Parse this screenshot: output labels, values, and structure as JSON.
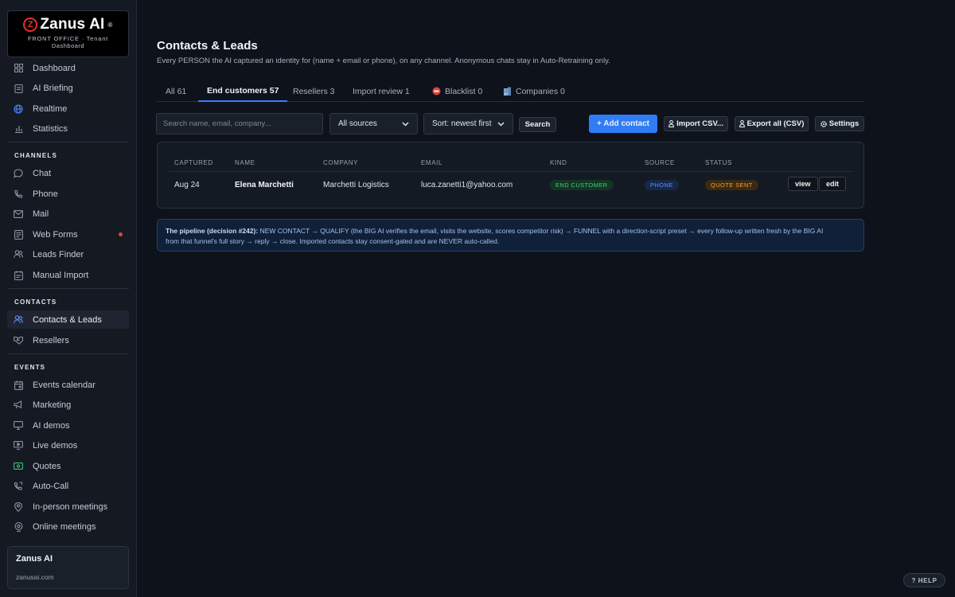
{
  "brand": {
    "name": "Zanus AI",
    "mark": "Z",
    "registered": "®",
    "line1": "FRONT OFFICE · Tenant",
    "line2": "Dashboard"
  },
  "nav": {
    "top": [
      {
        "label": "Dashboard",
        "icon": "grid-icon"
      },
      {
        "label": "AI Briefing",
        "icon": "clipboard-icon"
      },
      {
        "label": "Realtime",
        "icon": "globe-icon"
      },
      {
        "label": "Statistics",
        "icon": "bar-chart-icon"
      }
    ],
    "channels_title": "CHANNELS",
    "channels": [
      {
        "label": "Chat",
        "icon": "chat-icon"
      },
      {
        "label": "Phone",
        "icon": "phone-icon"
      },
      {
        "label": "Mail",
        "icon": "mail-icon"
      },
      {
        "label": "Web Forms",
        "icon": "form-icon",
        "dot": true
      },
      {
        "label": "Leads Finder",
        "icon": "people-icon"
      },
      {
        "label": "Manual Import",
        "icon": "import-icon"
      }
    ],
    "contacts_title": "CONTACTS",
    "contacts": [
      {
        "label": "Contacts & Leads",
        "icon": "users-icon",
        "active": true
      },
      {
        "label": "Resellers",
        "icon": "handshake-icon"
      }
    ],
    "events_title": "EVENTS",
    "events": [
      {
        "label": "Events calendar",
        "icon": "calendar-icon"
      },
      {
        "label": "Marketing",
        "icon": "megaphone-icon"
      },
      {
        "label": "AI demos",
        "icon": "monitor-icon"
      },
      {
        "label": "Live demos",
        "icon": "play-icon"
      },
      {
        "label": "Quotes",
        "icon": "money-icon"
      },
      {
        "label": "Auto-Call",
        "icon": "phone-auto-icon"
      },
      {
        "label": "In-person meetings",
        "icon": "pin-icon"
      },
      {
        "label": "Online meetings",
        "icon": "video-pin-icon"
      }
    ]
  },
  "tenant": {
    "name": "Zanus AI",
    "url": "zanusai.com"
  },
  "page": {
    "title": "Contacts & Leads",
    "subtitle": "Every PERSON the AI captured an identity for (name + email or phone), on any channel. Anonymous chats stay in Auto-Retraining only."
  },
  "tabs": [
    {
      "label": "All 61"
    },
    {
      "label": "End customers 57",
      "active": true
    },
    {
      "label": "Resellers 3"
    },
    {
      "label": "Import review 1"
    },
    {
      "label": "Blacklist 0",
      "icon": "no-entry-icon"
    },
    {
      "label": "Companies 0",
      "icon": "building-icon"
    }
  ],
  "toolbar": {
    "search_placeholder": "Search name, email, company...",
    "source_select": "All sources",
    "sort_select": "Sort: newest first",
    "search_btn": "Search",
    "add_btn": "+ Add contact",
    "import_btn": "Import CSV...",
    "export_btn": "Export all (CSV)",
    "settings_btn": "Settings"
  },
  "table": {
    "columns": [
      "CAPTURED",
      "NAME",
      "COMPANY",
      "EMAIL",
      "KIND",
      "SOURCE",
      "STATUS"
    ],
    "rows": [
      {
        "captured": "Aug 24",
        "name": "Elena Marchetti",
        "company": "Marchetti Logistics",
        "email": "luca.zanetti1@yahoo.com",
        "kind": "END CUSTOMER",
        "source": "PHONE",
        "status": "QUOTE SENT",
        "view": "view",
        "edit": "edit"
      }
    ]
  },
  "info": {
    "title": "The pipeline (decision #242):",
    "line1": " NEW CONTACT → QUALIFY (the BIG AI verifies the email, visits the website, scores competitor risk) → FUNNEL with a direction-script preset → every follow-up written fresh by the BIG AI",
    "line2": "from that funnel's full story → reply → close. Imported contacts stay consent-gated and are NEVER auto-called."
  },
  "help": "? HELP",
  "colors": {
    "accent": "#2f7cf6",
    "kind_green": "#3ed07a",
    "source_blue": "#5a95ff",
    "status_orange": "#f1a33a",
    "brand_red": "#e0322c"
  }
}
